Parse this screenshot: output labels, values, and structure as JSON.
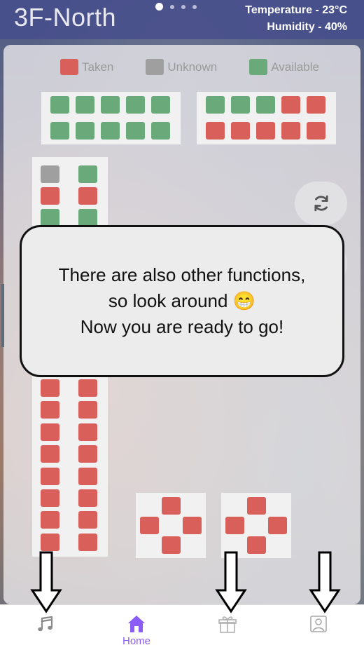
{
  "header": {
    "title": "3F-North",
    "temperature": "Temperature - 23°C",
    "humidity": "Humidity - 40%",
    "page_dots": 4,
    "active_dot": 0
  },
  "legend": [
    {
      "label": "Taken",
      "status": "taken"
    },
    {
      "label": "Unknown",
      "status": "unknown"
    },
    {
      "label": "Available",
      "status": "available"
    }
  ],
  "colors": {
    "taken": "#d9605a",
    "unknown": "#9f9f9f",
    "available": "#6aa97a",
    "accent": "#8b5cf6",
    "header_bg": "#464e8c"
  },
  "seat_blocks": {
    "top_left": [
      [
        "available",
        "available",
        "available",
        "available",
        "available"
      ],
      [
        "available",
        "available",
        "available",
        "available",
        "available"
      ]
    ],
    "top_right": [
      [
        "available",
        "available",
        "available",
        "taken",
        "taken"
      ],
      [
        "taken",
        "taken",
        "taken",
        "taken",
        "taken"
      ]
    ],
    "left_column_visible_top": [
      [
        "unknown",
        "available"
      ],
      [
        "taken",
        "taken"
      ],
      [
        "available",
        "available"
      ]
    ],
    "left_column_visible_bottom": [
      [
        "taken",
        "taken"
      ],
      [
        "taken",
        "taken"
      ],
      [
        "taken",
        "taken"
      ],
      [
        "taken",
        "taken"
      ],
      [
        "taken",
        "taken"
      ],
      [
        "taken",
        "taken"
      ],
      [
        "taken",
        "taken"
      ],
      [
        "taken",
        "taken"
      ]
    ],
    "cross_tables": [
      [
        "taken",
        "taken",
        "taken",
        "taken"
      ],
      [
        "taken",
        "taken",
        "taken",
        "taken"
      ]
    ]
  },
  "tutorial": {
    "line1": "There are also other functions,",
    "line2": "so look around 😁",
    "line3": "Now you are ready to go!"
  },
  "tabs": [
    {
      "id": "music",
      "icon": "music-note-icon",
      "label": ""
    },
    {
      "id": "home",
      "icon": "home-icon",
      "label": "Home"
    },
    {
      "id": "gift",
      "icon": "gift-icon",
      "label": ""
    },
    {
      "id": "profile",
      "icon": "profile-icon",
      "label": ""
    }
  ]
}
